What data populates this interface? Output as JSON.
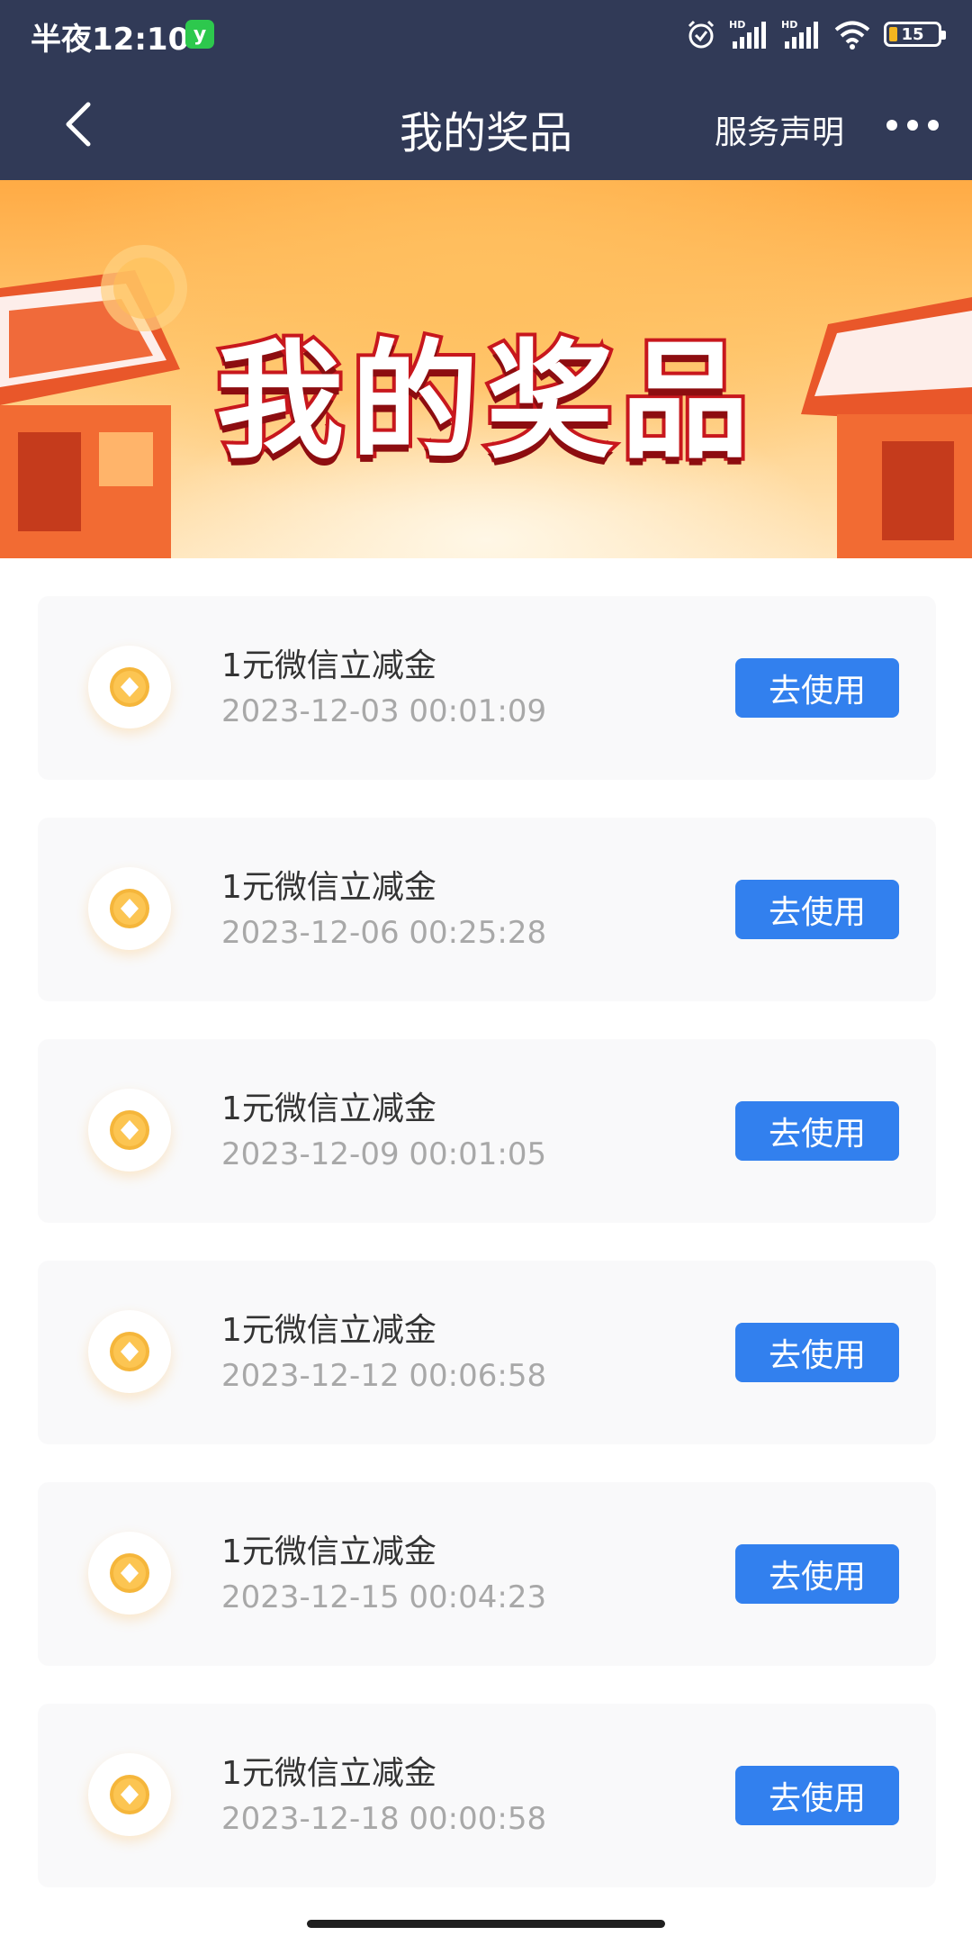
{
  "status_bar": {
    "time": "半夜12:10",
    "wechat_badge": "y",
    "battery": "15",
    "network_1": "HD",
    "network_2": "HD"
  },
  "navbar": {
    "title": "我的奖品",
    "service_link": "服务声明"
  },
  "banner": {
    "title": "我的奖品"
  },
  "prizes": [
    {
      "name": "1元微信立减金",
      "time": "2023-12-03 00:01:09",
      "action": "去使用"
    },
    {
      "name": "1元微信立减金",
      "time": "2023-12-06 00:25:28",
      "action": "去使用"
    },
    {
      "name": "1元微信立减金",
      "time": "2023-12-09 00:01:05",
      "action": "去使用"
    },
    {
      "name": "1元微信立减金",
      "time": "2023-12-12 00:06:58",
      "action": "去使用"
    },
    {
      "name": "1元微信立减金",
      "time": "2023-12-15 00:04:23",
      "action": "去使用"
    },
    {
      "name": "1元微信立减金",
      "time": "2023-12-18 00:00:58",
      "action": "去使用"
    }
  ],
  "colors": {
    "header_bg": "#313a57",
    "button_blue": "#3280ee",
    "coin_gold": "#f5b63b"
  }
}
